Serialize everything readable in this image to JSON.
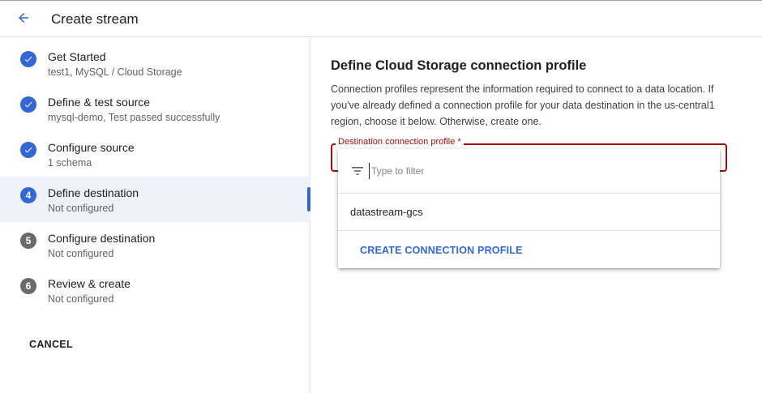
{
  "header": {
    "title": "Create stream",
    "back_icon": "arrow-back-icon"
  },
  "steps": [
    {
      "name": "Get Started",
      "sub": "test1, MySQL / Cloud Storage",
      "state": "done"
    },
    {
      "name": "Define & test source",
      "sub": "mysql-demo, Test passed successfully",
      "state": "done"
    },
    {
      "name": "Configure source",
      "sub": "1 schema",
      "state": "done"
    },
    {
      "name": "Define destination",
      "sub": "Not configured",
      "state": "current",
      "num": "4"
    },
    {
      "name": "Configure destination",
      "sub": "Not configured",
      "state": "todo",
      "num": "5"
    },
    {
      "name": "Review & create",
      "sub": "Not configured",
      "state": "todo",
      "num": "6"
    }
  ],
  "cancel_label": "CANCEL",
  "main": {
    "title": "Define Cloud Storage connection profile",
    "description": "Connection profiles represent the information required to connect to a data location. If you've already defined a connection profile for your data destination in the us-central1 region, choose it below. Otherwise, create one.",
    "field_label": "Destination connection profile *"
  },
  "dropdown": {
    "filter_placeholder": "Type to filter",
    "filter_value": "",
    "options": [
      "datastream-gcs"
    ],
    "create_label": "CREATE CONNECTION PROFILE"
  },
  "colors": {
    "accent": "#3367d6",
    "error": "#a50e0e",
    "active_bg": "#eef2f9"
  }
}
